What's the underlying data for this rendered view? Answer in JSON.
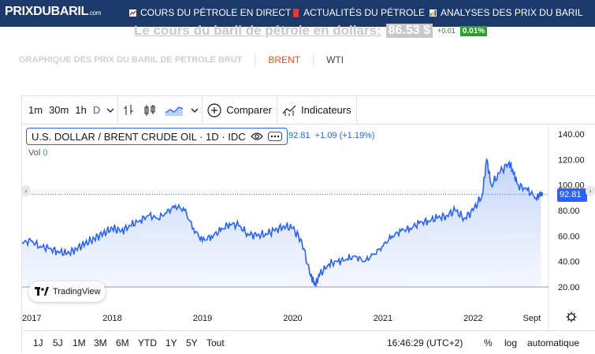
{
  "site": {
    "logo": "PRIXDUBARIL",
    "logo_suffix": ".com"
  },
  "nav": [
    {
      "label": "COURS DU PÉTROLE EN DIRECT",
      "icon": "chart-icon"
    },
    {
      "label": "ACTUALITÉS DU PÉTROLE",
      "icon": "news-icon"
    },
    {
      "label": "ANALYSES DES PRIX DU BARIL",
      "icon": "bar-chart-icon"
    }
  ],
  "header": {
    "title": "Le cours du baril de pétrole en dollars:",
    "price": "86.53 $",
    "change": "+0.01",
    "change_pct": "0.01%"
  },
  "tabs": {
    "title": "GRAPHIQUE DES PRIX DU BARIL DE PETROLE BRUT",
    "brent": "BRENT",
    "wti": "WTI"
  },
  "toolbar": {
    "intervals": [
      "1m",
      "30m",
      "1h",
      "D"
    ],
    "compare": "Comparer",
    "indicators": "Indicateurs"
  },
  "legend": {
    "symbol": "U.S. DOLLAR / BRENT CRUDE OIL · 1D · IDC",
    "last": "92.81",
    "change": "+1.09",
    "change_pct": "(+1.19%)",
    "vol_label": "Vol",
    "vol_value": "0"
  },
  "price_tag": "92.81",
  "tradingview_label": "TradingView",
  "chart_data": {
    "type": "area",
    "series": [
      {
        "x": [
          2017.0,
          2017.1,
          2017.2,
          2017.3,
          2017.4,
          2017.5,
          2017.6,
          2017.7,
          2017.8,
          2017.9,
          2018.0,
          2018.1,
          2018.2,
          2018.3,
          2018.4,
          2018.5,
          2018.6,
          2018.7,
          2018.8,
          2018.9,
          2019.0,
          2019.1,
          2019.2,
          2019.3,
          2019.4,
          2019.5,
          2019.6,
          2019.7,
          2019.8,
          2019.9,
          2020.0,
          2020.1,
          2020.2,
          2020.25,
          2020.3,
          2020.4,
          2020.5,
          2020.6,
          2020.7,
          2020.8,
          2020.9,
          2021.0,
          2021.1,
          2021.2,
          2021.3,
          2021.4,
          2021.5,
          2021.6,
          2021.7,
          2021.8,
          2021.9,
          2022.0,
          2022.1,
          2022.15,
          2022.2,
          2022.3,
          2022.4,
          2022.45,
          2022.5,
          2022.6,
          2022.7,
          2022.75
        ],
        "y": [
          55,
          56,
          52,
          50,
          48,
          46,
          50,
          54,
          58,
          62,
          66,
          64,
          68,
          72,
          76,
          74,
          78,
          84,
          80,
          66,
          56,
          60,
          64,
          70,
          68,
          62,
          60,
          62,
          64,
          68,
          66,
          56,
          28,
          22,
          30,
          38,
          40,
          42,
          44,
          40,
          46,
          52,
          60,
          64,
          66,
          70,
          72,
          74,
          76,
          80,
          74,
          80,
          92,
          120,
          100,
          110,
          118,
          108,
          100,
          96,
          90,
          92.81
        ]
      }
    ],
    "ylim": [
      20,
      140
    ],
    "yticks": [
      "140.00",
      "120.00",
      "100.00",
      "80.00",
      "60.00",
      "40.00",
      "20.00"
    ],
    "xticks": [
      "2017",
      "2018",
      "2019",
      "2020",
      "2021",
      "2022",
      "Sept"
    ]
  },
  "ranges": [
    "1J",
    "5J",
    "1M",
    "3M",
    "6M",
    "YTD",
    "1Y",
    "5Y",
    "Tout"
  ],
  "footer": {
    "time": "16:46:29 (UTC+2)",
    "pct": "%",
    "log": "log",
    "auto": "automatique"
  }
}
